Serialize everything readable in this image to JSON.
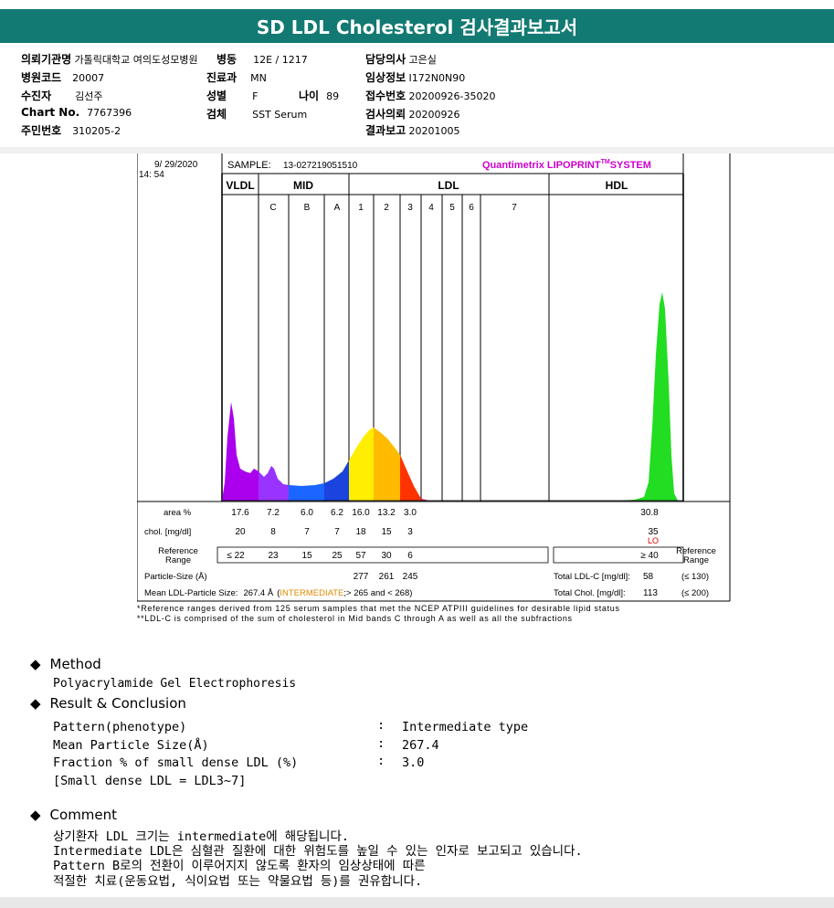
{
  "title": "SD LDL Cholesterol 검사결과보고서",
  "patient": {
    "col1": [
      {
        "label": "의뢰기관명",
        "value": "가톨릭대학교 여의도성모병원"
      },
      {
        "label": "병원코드",
        "value": "20007"
      },
      {
        "label": "수진자",
        "value": "김선주"
      },
      {
        "label": "Chart No.",
        "value": "7767396"
      },
      {
        "label": "주민번호",
        "value": "310205-2"
      }
    ],
    "col2": [
      {
        "label": "병동",
        "value": "12E / 1217"
      },
      {
        "label": "진료과",
        "value": "MN"
      },
      {
        "label": "성별",
        "value": "F"
      },
      {
        "label": "검체",
        "value": "SST Serum"
      }
    ],
    "age": {
      "label": "나이",
      "value": "89"
    },
    "col3": [
      {
        "label": "담당의사",
        "value": "고은실"
      },
      {
        "label": "임상정보",
        "value": "I172N0N90"
      },
      {
        "label": "접수번호",
        "value": "20200926-35020"
      },
      {
        "label": "검사의뢰",
        "value": "20200926"
      },
      {
        "label": "결과보고",
        "value": "20201005"
      }
    ]
  },
  "report": {
    "date": "9/ 29/2020",
    "time": "14: 54",
    "sample_label": "SAMPLE:",
    "sample_id": "13-027219051510",
    "brand": "Quantimetrix LIPOPRINT",
    "brand_tm": "TM",
    "brand_suffix": "SYSTEM",
    "sections": [
      "VLDL",
      "MID",
      "LDL",
      "HDL"
    ],
    "bands": [
      "C",
      "B",
      "A",
      "1",
      "2",
      "3",
      "4",
      "5",
      "6",
      "7"
    ],
    "row_area_label": "area %",
    "row_chol_label": "chol. [mg/dl]",
    "row_ref_label": "Reference\nRange",
    "area": [
      "17.6",
      "7.2",
      "6.0",
      "6.2",
      "16.0",
      "13.2",
      "3.0"
    ],
    "hdl_area": "30.8",
    "chol": [
      "20",
      "8",
      "7",
      "7",
      "18",
      "15",
      "3"
    ],
    "hdl_chol": "35",
    "hdl_flag": "LO",
    "ref": [
      "≤ 22",
      "23",
      "15",
      "25",
      "57",
      "30",
      "6"
    ],
    "hdl_ref": "≥ 40",
    "ref_right": "Reference\nRange",
    "particle_label": "Particle-Size (Å)",
    "particle": [
      "277",
      "261",
      "245"
    ],
    "mean_label": "Mean LDL-Particle Size:",
    "mean_value": "267.4 Å",
    "mean_type": "INTERMEDIATE",
    "mean_range": ";> 265 and < 268)",
    "total_ldl_label": "Total LDL-C [mg/dl]:",
    "total_ldl": "58",
    "total_ldl_ref": "(≤ 130)",
    "total_chol_label": "Total Chol. [mg/dl]:",
    "total_chol": "113",
    "total_chol_ref": "(≤ 200)",
    "footnote1": "*Reference ranges derived from 125 serum samples that met the NCEP ATPIII guidelines for desirable lipid status",
    "footnote2": "**LDL-C is comprised of the sum of cholesterol in Mid bands C through A as well as all the subfractions"
  },
  "method": {
    "heading": "Method",
    "text": "Polyacrylamide Gel Electrophoresis"
  },
  "result": {
    "heading": "Result & Conclusion",
    "rows": [
      {
        "label": "Pattern(phenotype)",
        "value": "Intermediate type"
      },
      {
        "label": "Mean Particle Size(Å)",
        "value": "267.4"
      },
      {
        "label": "Fraction % of small dense LDL (%)",
        "value": "3.0"
      }
    ],
    "colon": ":",
    "note": "[Small dense LDL = LDL3~7]"
  },
  "comment": {
    "heading": "Comment",
    "lines": [
      "상기환자 LDL 크기는 intermediate에 해당됩니다.",
      "Intermediate LDL은 심혈관 질환에 대한 위험도를 높일 수 있는 인자로 보고되고 있습니다.",
      "Pattern B로의 전환이 이루어지지 않도록 환자의 임상상태에 따른",
      "적절한 치료(운동요법, 식이요법 또는 약물요법 등)를 권유합니다."
    ]
  },
  "colors": {
    "title_bg": "#127a72",
    "brand": "#cc00cc",
    "intermediate": "#e08a00",
    "lo": "#e00000",
    "vldl": "#aa00ee",
    "mid_c": "#9933ff",
    "mid_b": "#1a66ff",
    "mid_a": "#1a44dd",
    "ldl1": "#ffee00",
    "ldl2": "#ffbb00",
    "ldl3": "#ff3300",
    "ldl4": "#dd1166",
    "hdl": "#22dd22"
  }
}
